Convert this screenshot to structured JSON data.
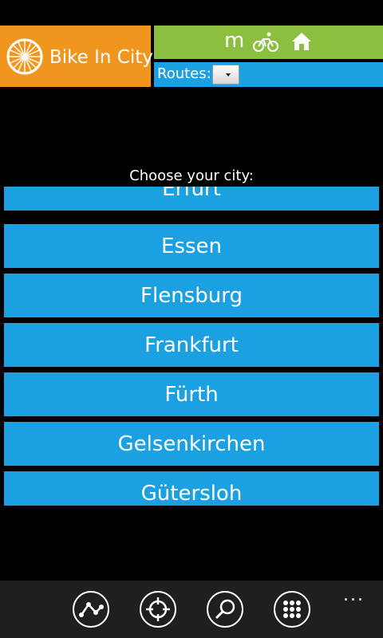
{
  "app": {
    "title": "Bike In City"
  },
  "header": {
    "mode_letter": "m",
    "routes_label": "Routes:"
  },
  "prompt": "Choose your city:",
  "cities": [
    "Erfurt",
    "Essen",
    "Flensburg",
    "Frankfurt",
    "Fürth",
    "Gelsenkirchen",
    "Gütersloh"
  ],
  "app_bar": {
    "buttons": [
      "route-icon",
      "locate-icon",
      "search-icon",
      "grid-icon"
    ],
    "more": "..."
  },
  "colors": {
    "orange": "#f0961e",
    "green": "#8cbf3f",
    "blue": "#1ba1e2",
    "background": "#000000",
    "appbar": "#1f1f1f"
  }
}
